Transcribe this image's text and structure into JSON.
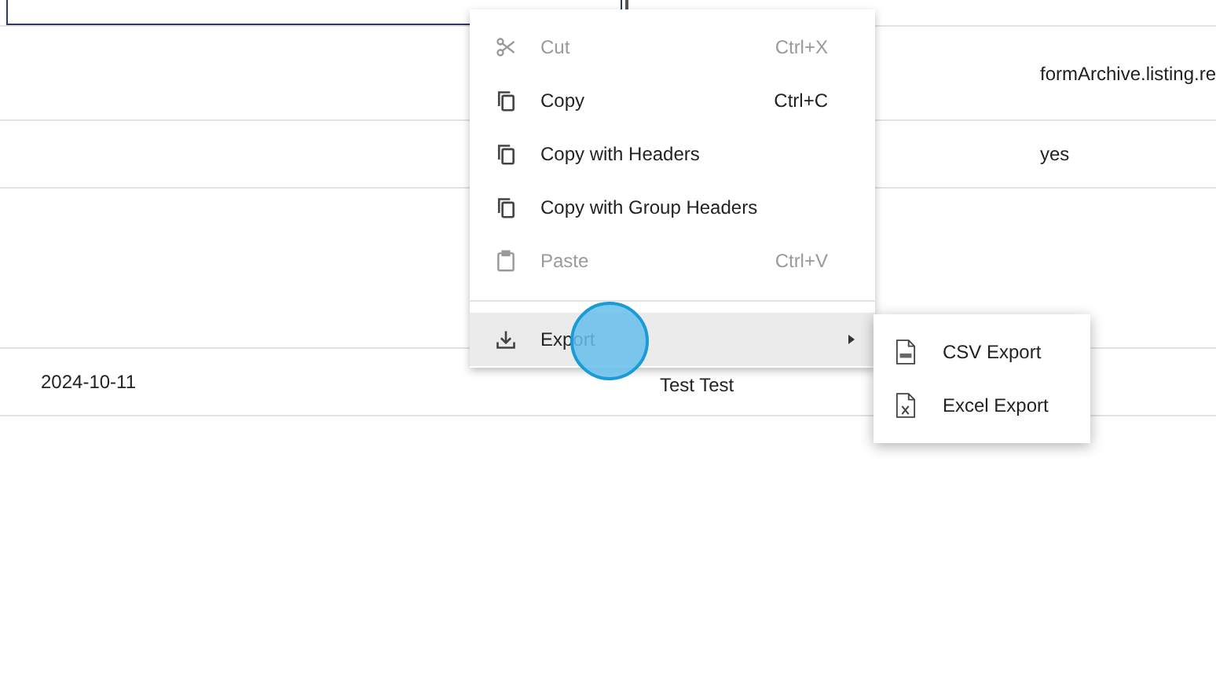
{
  "table": {
    "rows": [
      {
        "cells": [
          "",
          "",
          "formArchive.listing.re"
        ]
      },
      {
        "cells": [
          "",
          "",
          "yes"
        ]
      },
      {
        "cells": [
          "",
          "",
          ""
        ]
      },
      {
        "cells": [
          "2024-10-11",
          "Test Test",
          ""
        ]
      }
    ]
  },
  "context_menu": {
    "items": [
      {
        "kind": "cut",
        "label": "Cut",
        "shortcut": "Ctrl+X",
        "disabled": true,
        "selected": false
      },
      {
        "kind": "copy",
        "label": "Copy",
        "shortcut": "Ctrl+C",
        "disabled": false,
        "selected": false
      },
      {
        "kind": "copy",
        "label": "Copy with Headers",
        "disabled": false,
        "selected": false
      },
      {
        "kind": "copy",
        "label": "Copy with Group Headers",
        "disabled": false,
        "selected": false
      },
      {
        "kind": "paste",
        "label": "Paste",
        "shortcut": "Ctrl+V",
        "disabled": true,
        "selected": false
      },
      {
        "kind": "separator"
      },
      {
        "kind": "export",
        "label": "Export",
        "disabled": false,
        "selected": true
      }
    ]
  },
  "submenu": {
    "items": [
      {
        "kind": "csv",
        "label": "CSV Export"
      },
      {
        "kind": "excel",
        "label": "Excel Export"
      }
    ]
  }
}
